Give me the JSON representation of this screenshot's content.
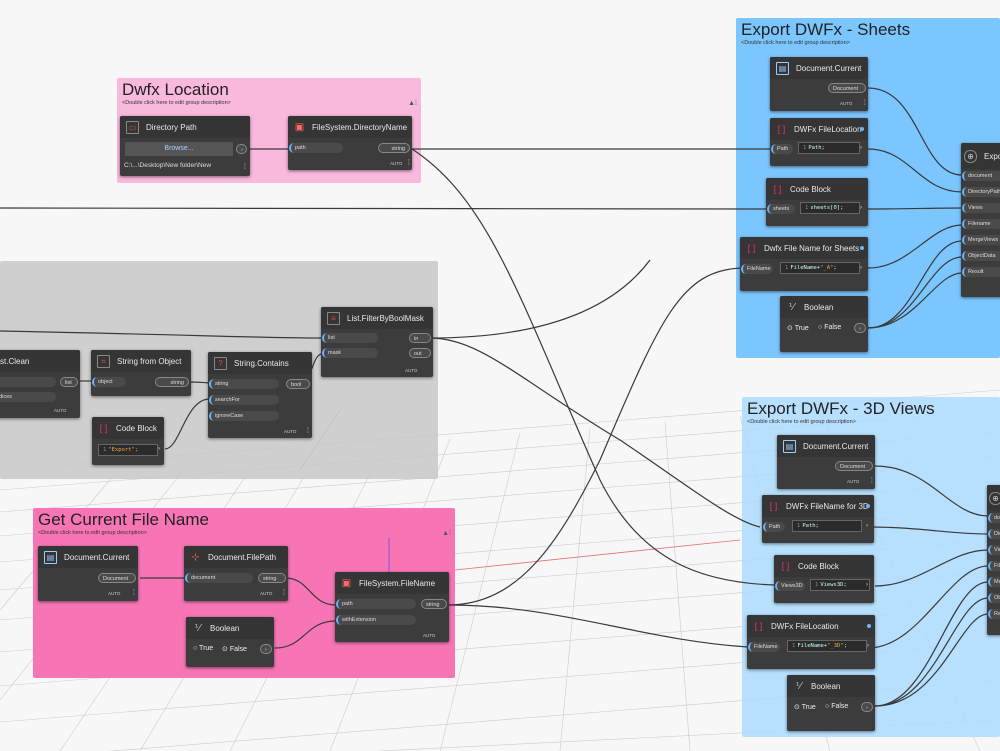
{
  "colors": {
    "pink_group": "#f9b9dd",
    "hotpink_group": "#f775b5",
    "blue_group": "#7cc6ff",
    "gray_group": "#d0d0d0",
    "node_bg": "#3c3c3c",
    "wire": "#3a3a3a"
  },
  "groups": {
    "dwfx_location": {
      "title": "Dwfx Location",
      "desc": "<Double click here to edit group description>"
    },
    "export_sheets": {
      "title": "Export DWFx - Sheets",
      "desc": "<Double click here to edit group description>"
    },
    "export_3d": {
      "title": "Export DWFx - 3D Views",
      "desc": "<Double click here to edit group description>"
    },
    "get_file_name": {
      "title": "Get Current File Name",
      "desc": "<Double click here to edit group description>"
    }
  },
  "nodes": {
    "directory_path": {
      "title": "Directory Path",
      "browse": "Browse...",
      "path_value": "C:\\...\\Desktop\\New folder\\New"
    },
    "fs_directory_name": {
      "title": "FileSystem.DirectoryName",
      "in": "path",
      "out": "string",
      "auto": "AUTO"
    },
    "list_clean": {
      "title": "st.Clean",
      "in1": "",
      "in2": "ndices",
      "out": "list",
      "auto": "AUTO"
    },
    "string_from_object": {
      "title": "String from Object",
      "in": "object",
      "out": "string"
    },
    "string_contains": {
      "title": "String.Contains",
      "in1": "string",
      "in2": "searchFor",
      "in3": "ignoreCase",
      "out": "bool",
      "auto": "AUTO"
    },
    "list_filter": {
      "title": "List.FilterByBoolMask",
      "in1": "list",
      "in2": "mask",
      "out1": "in",
      "out2": "out",
      "auto": "AUTO"
    },
    "code_block_export": {
      "title": "Code Block",
      "line": "1",
      "code": "\"Export\";"
    },
    "doc_current_left": {
      "title": "Document.Current",
      "out": "Document",
      "auto": "AUTO"
    },
    "doc_filepath": {
      "title": "Document.FilePath",
      "in": "document",
      "out": "string",
      "auto": "AUTO"
    },
    "bool_left": {
      "title": "Boolean",
      "true_label": "True",
      "false_label": "False"
    },
    "fs_filename": {
      "title": "FileSystem.FileName",
      "in1": "path",
      "in2": "withExtension",
      "out": "string",
      "auto": "AUTO"
    },
    "doc_current_sheets": {
      "title": "Document.Current",
      "out": "Document",
      "auto": "AUTO"
    },
    "dwfx_file_location_sheets": {
      "title": "DWFx FileLocation",
      "in": "Path",
      "line": "1",
      "code": "Path;"
    },
    "code_block_sheets": {
      "title": "Code Block",
      "in": "sheets",
      "line": "1",
      "code": "sheets[0];"
    },
    "dwfx_file_name_sheets": {
      "title": "Dwfx File Name for Sheets",
      "in": "FileName",
      "line": "1",
      "code_a": "FileName+",
      "code_b": "\"_A\"",
      "code_c": ";"
    },
    "bool_sheets": {
      "title": "Boolean",
      "true_label": "True",
      "false_label": "False"
    },
    "export_sheets_node": {
      "title": "Expo",
      "ports": [
        "document",
        "DirectoryPath",
        "Views",
        "Filename",
        "MergeViews",
        "ObjectData",
        "Result"
      ]
    },
    "doc_current_3d": {
      "title": "Document.Current",
      "out": "Document",
      "auto": "AUTO"
    },
    "dwfx_filename_3d": {
      "title": "DWFx FileName for 3D",
      "in": "Path",
      "line": "1",
      "code": "Path;"
    },
    "code_block_3d": {
      "title": "Code Block",
      "in": "Views3D",
      "line": "1",
      "code": "Views3D;"
    },
    "dwfx_file_location_3d": {
      "title": "DWFx FileLocation",
      "in": "FileName",
      "line": "1",
      "code_a": "FileName+",
      "code_b": "\"_3D\"",
      "code_c": ";"
    },
    "bool_3d": {
      "title": "Boolean",
      "true_label": "True",
      "false_label": "False"
    },
    "export_3d_node": {
      "title": "",
      "ports": [
        "doc",
        "Dire",
        "View",
        "File",
        "Mer",
        "Obj",
        "Res"
      ]
    }
  }
}
